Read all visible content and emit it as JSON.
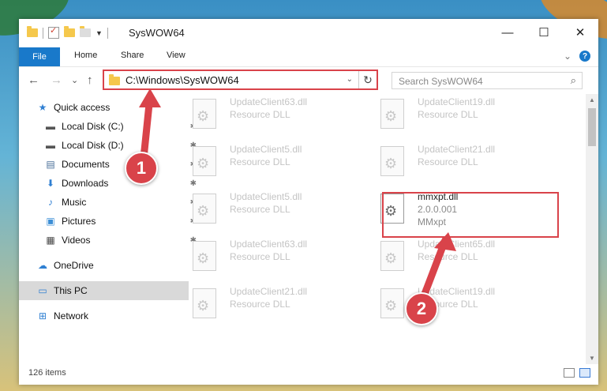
{
  "window": {
    "title": "SysWOW64"
  },
  "caption": {
    "minimize": "—",
    "maximize": "☐",
    "close": "✕"
  },
  "ribbon": {
    "tabs": [
      "File",
      "Home",
      "Share",
      "View"
    ],
    "collapse": "⌄",
    "help": "?"
  },
  "nav": {
    "back": "←",
    "forward": "→",
    "recent": "⌄",
    "up": "↑"
  },
  "address": {
    "path": "C:\\Windows\\SysWOW64",
    "dropdown": "⌄",
    "refresh": "↻"
  },
  "search": {
    "placeholder": "Search SysWOW64",
    "icon": "search-icon"
  },
  "sidebar": {
    "items": [
      {
        "label": "Quick access",
        "icon": "star-icon",
        "glyph": "★",
        "color": "#2f7fd2",
        "pinned": false
      },
      {
        "label": "Local Disk (C:)",
        "icon": "drive-icon",
        "glyph": "▬",
        "color": "#555555",
        "pinned": true
      },
      {
        "label": "Local Disk (D:)",
        "icon": "drive-icon",
        "glyph": "▬",
        "color": "#555555",
        "pinned": true
      },
      {
        "label": "Documents",
        "icon": "documents-icon",
        "glyph": "▤",
        "color": "#4a6f99",
        "pinned": true
      },
      {
        "label": "Downloads",
        "icon": "downloads-icon",
        "glyph": "⬇",
        "color": "#2f7fd2",
        "pinned": true
      },
      {
        "label": "Music",
        "icon": "music-icon",
        "glyph": "♪",
        "color": "#2f7fd2",
        "pinned": true
      },
      {
        "label": "Pictures",
        "icon": "pictures-icon",
        "glyph": "▣",
        "color": "#3d8fd6",
        "pinned": true
      },
      {
        "label": "Videos",
        "icon": "videos-icon",
        "glyph": "▦",
        "color": "#444444",
        "pinned": true
      },
      {
        "label": "OneDrive",
        "icon": "cloud-icon",
        "glyph": "☁",
        "color": "#2f7fd2",
        "pinned": false
      },
      {
        "label": "This PC",
        "icon": "computer-icon",
        "glyph": "▭",
        "color": "#2f7fd2",
        "pinned": false
      },
      {
        "label": "Network",
        "icon": "network-icon",
        "glyph": "⊞",
        "color": "#2f7fd2",
        "pinned": false
      }
    ],
    "pin_glyph": "📌"
  },
  "files": [
    {
      "name": "UpdateClient63.dll",
      "type": "Resource DLL"
    },
    {
      "name": "UpdateClient19.dll",
      "type": "Resource DLL"
    },
    {
      "name": "UpdateClient5.dll",
      "type": "Resource DLL"
    },
    {
      "name": "UpdateClient21.dll",
      "type": "Resource DLL"
    },
    {
      "name": "UpdateClient5.dll",
      "type": "Resource DLL"
    },
    {
      "name": "mmxpt.dll",
      "version": "2.0.0.001",
      "type": "MMxpt",
      "highlighted": true
    },
    {
      "name": "UpdateClient63.dll",
      "type": "Resource DLL"
    },
    {
      "name": "UpdateClient65.dll",
      "type": "Resource DLL"
    },
    {
      "name": "UpdateClient21.dll",
      "type": "Resource DLL"
    },
    {
      "name": "UpdateClient19.dll",
      "type": "Resource DLL"
    }
  ],
  "status": {
    "item_count": "126 items"
  },
  "markers": [
    "1",
    "2"
  ],
  "colors": {
    "accent": "#1979ca",
    "highlight": "#d9434a",
    "selected_bg": "#d9d9d9"
  }
}
